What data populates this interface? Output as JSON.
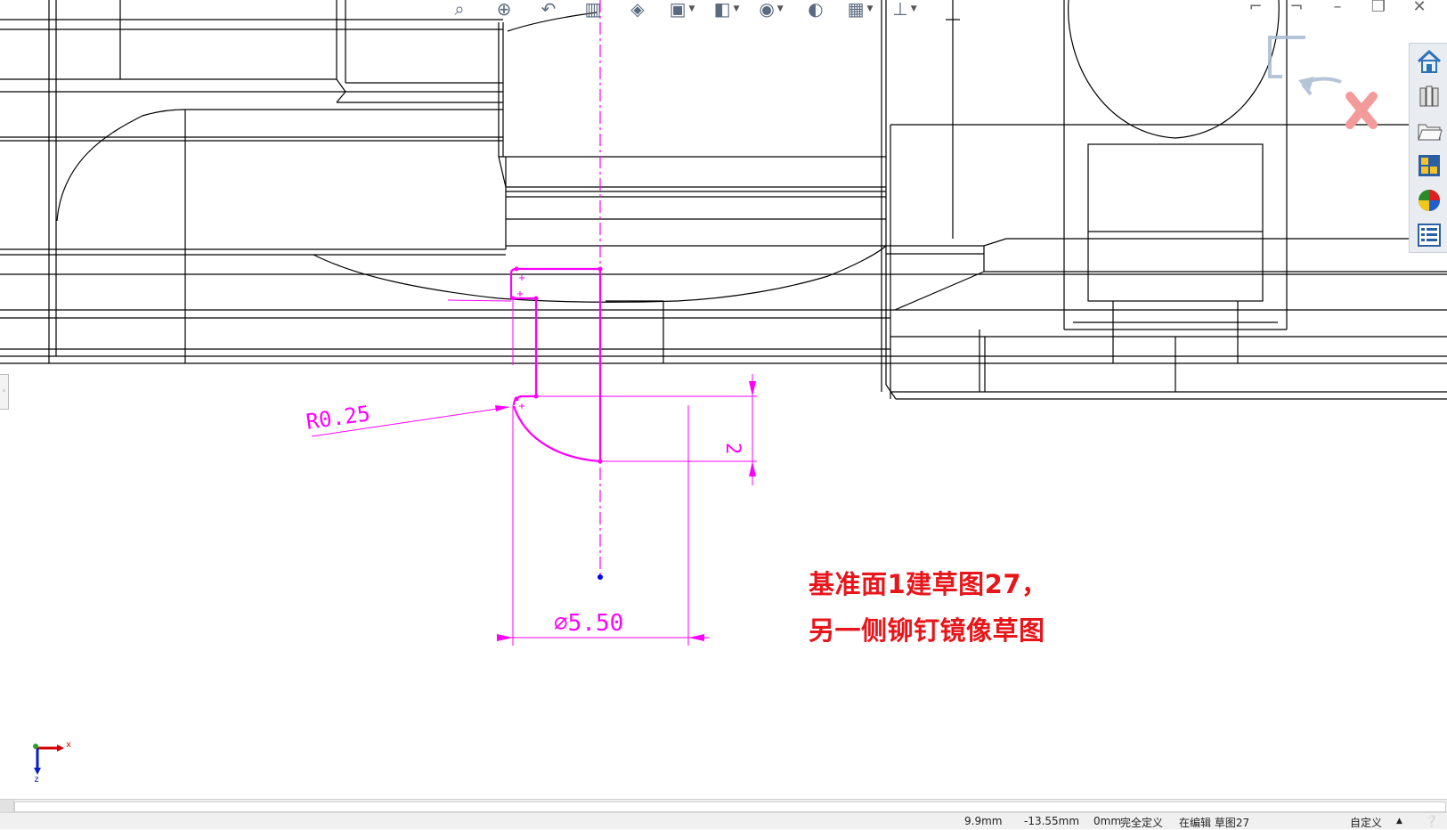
{
  "drawing": {
    "dimension_radius": "R0.25",
    "dimension_height": "2",
    "dimension_diameter": "⌀5.50",
    "triad_x_label": "x",
    "triad_z_label": "z"
  },
  "annotation": {
    "line1": "基准面1建草图27，",
    "line2": "另一侧铆钉镜像草图"
  },
  "statusbar": {
    "x_coord": "9.9mm",
    "y_coord": "-13.55mm",
    "z_coord": "0mm",
    "definition_state": "完全定义",
    "editing": "在编辑 草图27",
    "units": "自定义"
  },
  "colors": {
    "sketch": "#ff00ff",
    "annotation": "#e8161b",
    "geometry": "#000000",
    "origin_point": "#0000ff"
  },
  "icons": {
    "toolbar": [
      "zoom-to-fit-icon",
      "zoom-area-icon",
      "previous-view-icon",
      "section-view-icon",
      "view-orientation-icon",
      "display-style-icon",
      "hide-show-icon",
      "edit-appearance-icon",
      "apply-scene-icon",
      "view-settings-icon"
    ],
    "sidebar": [
      "home-icon",
      "design-library-icon",
      "file-explorer-icon",
      "view-palette-icon",
      "appearances-icon",
      "custom-properties-icon"
    ]
  }
}
